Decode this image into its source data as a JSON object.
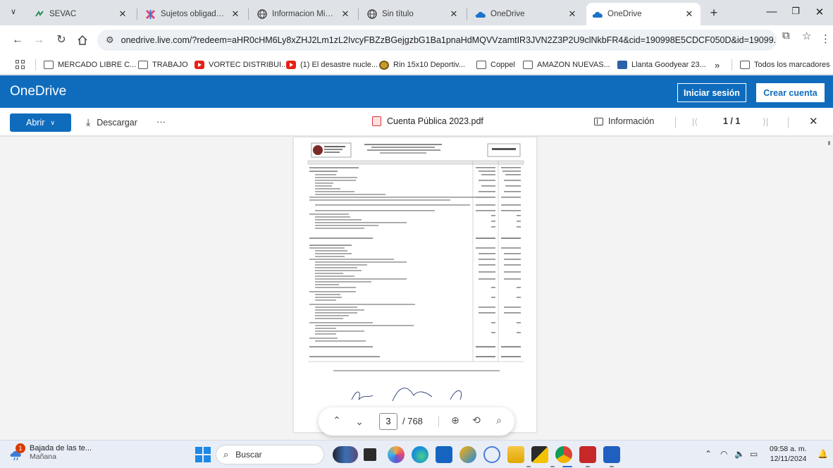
{
  "browser": {
    "tabs": [
      {
        "title": "SEVAC",
        "active": false
      },
      {
        "title": "Sujetos obligados - I",
        "active": false
      },
      {
        "title": "Informacion Minima I",
        "active": false
      },
      {
        "title": "Sin título",
        "active": false
      },
      {
        "title": "OneDrive",
        "active": false
      },
      {
        "title": "OneDrive",
        "active": true
      }
    ],
    "new_tab": "+",
    "url": "onedrive.live.com/?redeem=aHR0cHM6Ly8xZHJ2Lm1zL2IvcyFBZzBGejgzbG1Ba1pnaHdMQVVzamtIR3JVN2Z3P2U9clNkbFR4&cid=190998E5CDCF050D&id=19099...",
    "bookmarks": [
      {
        "label": "MERCADO LIBRE C...",
        "icon": "folder-icon"
      },
      {
        "label": "TRABAJO",
        "icon": "folder-icon"
      },
      {
        "label": "VORTEC DISTRIBUI...",
        "icon": "youtube-icon"
      },
      {
        "label": "(1) El desastre nucle...",
        "icon": "youtube-icon"
      },
      {
        "label": "Rin 15x10 Deportiv...",
        "icon": "wheel-icon"
      },
      {
        "label": "Coppel",
        "icon": "folder-icon"
      },
      {
        "label": "AMAZON NUEVAS...",
        "icon": "folder-icon"
      },
      {
        "label": "Llanta Goodyear 23...",
        "icon": "tire-icon"
      }
    ],
    "bookmarks_overflow": "»",
    "all_bookmarks": "Todos los marcadores"
  },
  "onedrive": {
    "brand": "OneDrive",
    "signin": "Iniciar sesión",
    "create_account": "Crear cuenta"
  },
  "viewer": {
    "open": "Abrir",
    "download": "Descargar",
    "more": "···",
    "file_name": "Cuenta Pública 2023.pdf",
    "info": "Información",
    "page_position": "1 / 1",
    "current_page": "3",
    "total_pages": "/ 768"
  },
  "taskbar": {
    "weather_title": "Bajada de las te...",
    "weather_sub": "Mañana",
    "weather_badge": "1",
    "search": "Buscar",
    "time": "09:58 a. m.",
    "date": "12/11/2024"
  },
  "colors": {
    "onedrive_blue": "#0f6cbd",
    "tab_strip": "#dfe3e8",
    "canvas": "#f3f3f3",
    "taskbar": "#e9eef6"
  }
}
